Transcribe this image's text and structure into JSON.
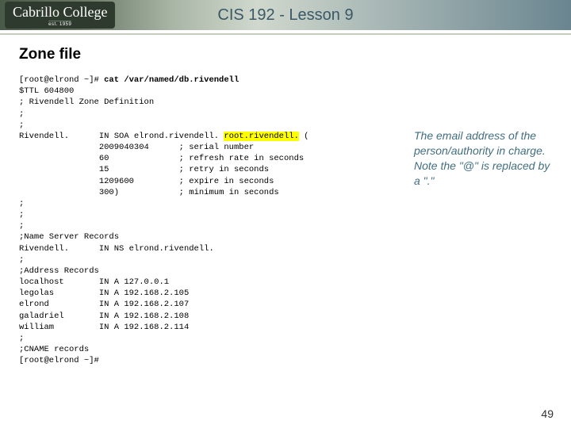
{
  "header": {
    "logo_text": "Cabrillo College",
    "logo_est": "est. 1959",
    "title": "CIS 192 - Lesson 9"
  },
  "section_title": "Zone file",
  "code": {
    "prompt1": "[root@elrond ~]# ",
    "command": "cat /var/named/db.rivendell",
    "ttl_line": "$TTL 604800",
    "defcomment": "; Rivendell Zone Definition",
    "sc1": ";",
    "sc2": ";",
    "soa_label": "Rivendell.",
    "soa_pre": "IN SOA elrond.rivendell. ",
    "soa_hl": "root.rivendell.",
    "soa_post": " (",
    "serial_val": "2009040304",
    "serial_cmt": "; serial number",
    "refresh_val": "60",
    "refresh_cmt": "; refresh rate in seconds",
    "retry_val": "15",
    "retry_cmt": "; retry in seconds",
    "expire_val": "1209600",
    "expire_cmt": "; expire in seconds",
    "min_val": "300)",
    "min_cmt": "; minimum in seconds",
    "sc3": ";",
    "sc4": ";",
    "sc5": ";",
    "ns_header": ";Name Server Records",
    "ns_label": "Rivendell.",
    "ns_record": "IN NS elrond.rivendell.",
    "sc6": ";",
    "addr_header": ";Address Records",
    "a1_name": "localhost",
    "a1_rec": "IN A 127.0.0.1",
    "a2_name": "legolas",
    "a2_rec": "IN A 192.168.2.105",
    "a3_name": "elrond",
    "a3_rec": "IN A 192.168.2.107",
    "a4_name": "galadriel",
    "a4_rec": "IN A 192.168.2.108",
    "a5_name": "william",
    "a5_rec": "IN A 192.168.2.114",
    "sc7": ";",
    "cname_header": ";CNAME records",
    "prompt2": "[root@elrond ~]#"
  },
  "annotation": "The email address of the person/authority in charge.  Note the \"@\" is replaced by a \".\"",
  "slide_number": "49"
}
